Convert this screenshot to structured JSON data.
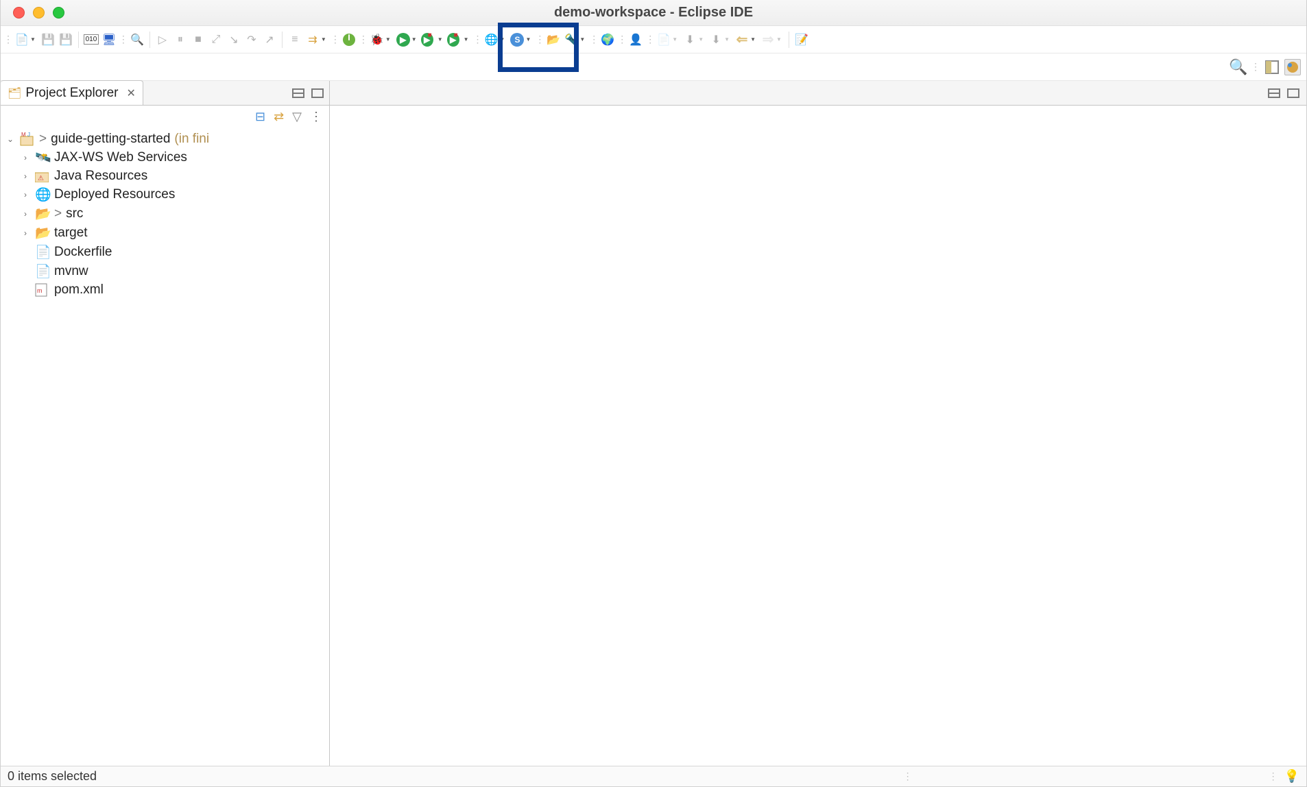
{
  "window": {
    "title": "demo-workspace - Eclipse IDE"
  },
  "sidebar_view": {
    "title": "Project Explorer"
  },
  "tree": {
    "project": {
      "marker": ">",
      "name": "guide-getting-started",
      "suffix": "(in fini"
    },
    "children": [
      {
        "label": "JAX-WS Web Services",
        "icon": "webservice",
        "expandable": true
      },
      {
        "label": "Java Resources",
        "icon": "java-resources",
        "expandable": true
      },
      {
        "label": "Deployed Resources",
        "icon": "deployed",
        "expandable": true
      },
      {
        "label": "src",
        "icon": "folder-open",
        "expandable": true,
        "marker": "> "
      },
      {
        "label": "target",
        "icon": "folder-open",
        "expandable": true
      },
      {
        "label": "Dockerfile",
        "icon": "file",
        "expandable": false
      },
      {
        "label": "mvnw",
        "icon": "file",
        "expandable": false
      },
      {
        "label": "pom.xml",
        "icon": "xml-file",
        "expandable": false
      }
    ]
  },
  "status": {
    "text": "0 items selected"
  }
}
